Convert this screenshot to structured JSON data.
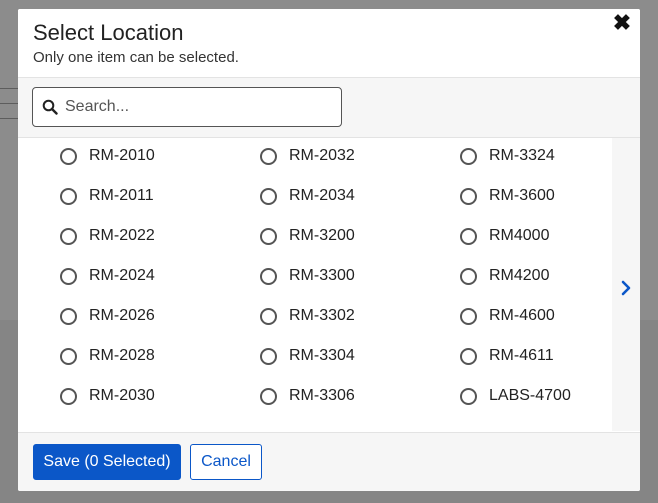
{
  "dialog": {
    "title": "Select Location",
    "subtitle": "Only one item can be selected.",
    "close_icon": "close-icon"
  },
  "search": {
    "placeholder": "Search...",
    "value": ""
  },
  "locations": {
    "columns": [
      [
        "RM-2010",
        "RM-2011",
        "RM-2022",
        "RM-2024",
        "RM-2026",
        "RM-2028",
        "RM-2030"
      ],
      [
        "RM-2032",
        "RM-2034",
        "RM-3200",
        "RM-3300",
        "RM-3302",
        "RM-3304",
        "RM-3306"
      ],
      [
        "RM-3324",
        "RM-3600",
        "RM4000",
        "RM4200",
        "RM-4600",
        "RM-4611",
        "LABS-4700"
      ]
    ],
    "selected": null
  },
  "pager": {
    "next_icon": "chevron-right-icon"
  },
  "footer": {
    "save_label": "Save (0 Selected)",
    "cancel_label": "Cancel"
  },
  "colors": {
    "accent": "#0b57c8",
    "backdrop": "#8c8c8c",
    "panel": "#f6f6f6"
  }
}
